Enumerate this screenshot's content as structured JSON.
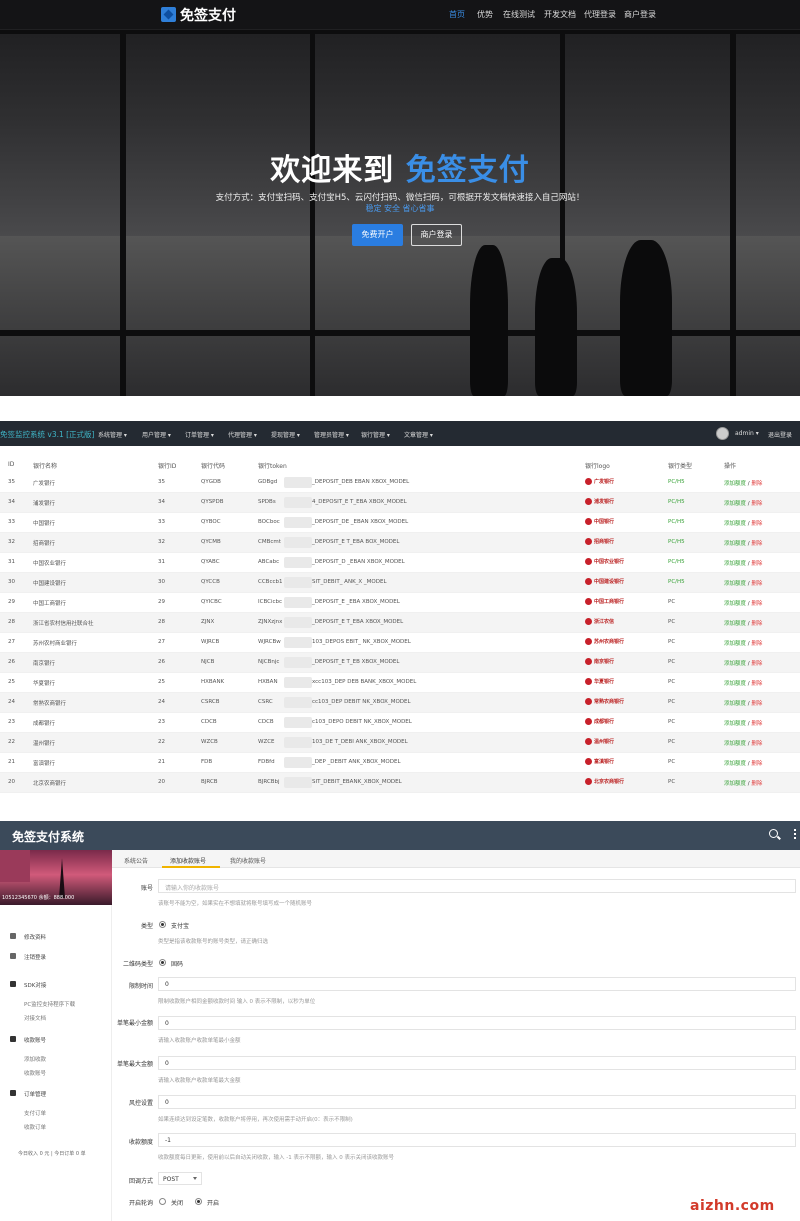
{
  "landing": {
    "brand": "免签支付",
    "nav": [
      "首页",
      "优势",
      "在线测试",
      "开发文档",
      "代理登录",
      "商户登录"
    ],
    "title_main": "欢迎来到",
    "title_highlight": "免签支付",
    "subtitle": "支付方式：支付宝扫码、支付宝H5、云闪付扫码、微信扫码，可根据开发文档快速接入自己网站！",
    "tags": "稳定  安全  省心省事",
    "register_button": "免费开户",
    "login_button": "商户登录"
  },
  "bank_admin": {
    "system_name": "免签监控系统 v3.1 [正式版]",
    "menus": [
      "系统管理 ▾",
      "用户管理 ▾",
      "订单管理 ▾",
      "代理管理 ▾",
      "提现管理 ▾",
      "管理员管理 ▾",
      "银行管理 ▾",
      "文章管理 ▾"
    ],
    "user": "admin ▾",
    "logout": "退出登录",
    "headers": [
      "ID",
      "银行名称",
      "银行ID",
      "银行代码",
      "银行token",
      "银行logo",
      "银行类型",
      "操作"
    ],
    "rows": [
      {
        "id": "35",
        "name": "广发银行",
        "bid": "35",
        "code": "QYGDB",
        "token": "GDBgd",
        "token_tail": "_DEPOSIT_DEB       EBAN     XBOX_MODEL",
        "logo": "广发银行",
        "type": "PC/H5"
      },
      {
        "id": "34",
        "name": "浦发银行",
        "bid": "34",
        "code": "QYSPDB",
        "token": "SPDBs",
        "token_tail": "4_DEPOSIT_E      T_EBA     XBOX_MODEL",
        "logo": "浦发银行",
        "type": "PC/H5"
      },
      {
        "id": "33",
        "name": "中国银行",
        "bid": "33",
        "code": "QYBOC",
        "token": "BOCboc",
        "token_tail": "_DEPOSIT_DE      _EBAN     XBOX_MODEL",
        "logo": "中国银行",
        "type": "PC/H5"
      },
      {
        "id": "32",
        "name": "招商银行",
        "bid": "32",
        "code": "QYCMB",
        "token": "CMBcmt",
        "token_tail": "_DEPOSIT_E      T_EBA     BOX_MODEL",
        "logo": "招商银行",
        "type": "PC/H5"
      },
      {
        "id": "31",
        "name": "中国农业银行",
        "bid": "31",
        "code": "QYABC",
        "token": "ABCabc",
        "token_tail": "_DEPOSIT_D      _EBAN     XBOX_MODEL",
        "logo": "中国农业银行",
        "type": "PC/H5"
      },
      {
        "id": "30",
        "name": "中国建设银行",
        "bid": "30",
        "code": "QYCCB",
        "token": "CCBccb1",
        "token_tail": "SIT_DEBIT_     ANK_X     _MODEL",
        "logo": "中国建设银行",
        "type": "PC/H5"
      },
      {
        "id": "29",
        "name": "中国工商银行",
        "bid": "29",
        "code": "QYICBC",
        "token": "ICBCicbc",
        "token_tail": "_DEPOSIT_E      _EBA     XBOX_MODEL",
        "logo": "中国工商银行",
        "type": "PC"
      },
      {
        "id": "28",
        "name": "浙江省农村信用社联合社",
        "bid": "28",
        "code": "ZJNX",
        "token": "ZJNXzjnx",
        "token_tail": "_DEPOSIT_E      T_EBA     XBOX_MODEL",
        "logo": "浙江农信",
        "type": "PC"
      },
      {
        "id": "27",
        "name": "苏州农村商业银行",
        "bid": "27",
        "code": "WJRCB",
        "token": "WJRCBw",
        "token_tail": "103_DEPOS      EBIT_     NK_XBOX_MODEL",
        "logo": "苏州农商银行",
        "type": "PC"
      },
      {
        "id": "26",
        "name": "南京银行",
        "bid": "26",
        "code": "NJCB",
        "token": "NJCBnjc",
        "token_tail": "_DEPOSIT_E      T_EB     XBOX_MODEL",
        "logo": "南京银行",
        "type": "PC"
      },
      {
        "id": "25",
        "name": "华夏银行",
        "bid": "25",
        "code": "HXBANK",
        "token": "HXBAN",
        "token_tail": "xcc103_DEP      DEB     BANK_XBOX_MODEL",
        "logo": "华夏银行",
        "type": "PC"
      },
      {
        "id": "24",
        "name": "常熟农商银行",
        "bid": "24",
        "code": "CSRCB",
        "token": "CSRC",
        "token_tail": "cc103_DEP      DEBIT     NK_XBOX_MODEL",
        "logo": "常熟农商银行",
        "type": "PC"
      },
      {
        "id": "23",
        "name": "成都银行",
        "bid": "23",
        "code": "CDCB",
        "token": "CDCB",
        "token_tail": "c103_DEPO      DEBIT     NK_XBOX_MODEL",
        "logo": "成都银行",
        "type": "PC"
      },
      {
        "id": "22",
        "name": "温州银行",
        "bid": "22",
        "code": "WZCB",
        "token": "WZCE",
        "token_tail": "103_DE      T_DEBI     ANK_XBOX_MODEL",
        "logo": "温州银行",
        "type": "PC"
      },
      {
        "id": "21",
        "name": "富滇银行",
        "bid": "21",
        "code": "FDB",
        "token": "FDBfd",
        "token_tail": "_DEP      _DEBIT     ANK_XBOX_MODEL",
        "logo": "富滇银行",
        "type": "PC"
      },
      {
        "id": "20",
        "name": "北京农商银行",
        "bid": "20",
        "code": "BJRCB",
        "token": "BJRCBbj",
        "token_tail": "SIT_DEBIT_EBANK_XBOX_MODEL",
        "logo": "北京农商银行",
        "type": "PC"
      }
    ],
    "action_add": "添加额度",
    "action_sep": " / ",
    "action_del": "删除"
  },
  "account_form": {
    "title": "免签支付系统",
    "profile_id": "10512345670",
    "profile_balance": "余额：888.000",
    "side_items": [
      "修改资料",
      "注销登录"
    ],
    "side_sdk": "SDK对接",
    "side_sdk_subs": [
      "PC监控支持程序下载",
      "对接文档"
    ],
    "side_account": "收款账号",
    "side_account_subs": [
      "添加收款",
      "收款账号"
    ],
    "side_order": "订单管理",
    "side_order_subs": [
      "支付订单",
      "收款订单"
    ],
    "stats": "今日收入 0 元 | 今日订单 0 单",
    "tabs": [
      "系统公告",
      "添加收款账号",
      "我的收款账号"
    ],
    "fields": {
      "account_label": "账号",
      "account_placeholder": "请输入你的收款账号",
      "account_help": "该账号不能为空，如果实在不想填就将账号填写成一个随机账号",
      "type_label": "类型",
      "type_option": "支付宝",
      "type_help": "类型是指该收款账号的账号类型，请正确归选",
      "qr_label": "二维码类型",
      "qr_option": "固码",
      "limit_time_label": "限制时间",
      "limit_time_value": "0",
      "limit_time_help": "限制收款账户相同金额收款时间 输入 0 表示不限制，以秒为单位",
      "min_label": "单笔最小金额",
      "min_value": "0",
      "min_help": "请输入收款账户收款单笔最小金额",
      "max_label": "单笔最大金额",
      "max_value": "0",
      "max_help": "请输入收款账户收款单笔最大金额",
      "risk_label": "风控设置",
      "risk_value": "0",
      "risk_help": "如果连续达到设定笔数，收款账户将停用，再次使用需手动开启(0：表示不限制)",
      "quota_label": "收款额度",
      "quota_value": "-1",
      "quota_help": "收款额度每日更新，使用前以后自动关闭收款，输入 -1 表示不限额，输入 0 表示关闭该收款账号",
      "callback_label": "回调方式",
      "callback_value": "POST",
      "polling_label": "开启轮询",
      "polling_off": "关闭",
      "polling_on": "开启"
    }
  },
  "watermark": "aizhn.com"
}
